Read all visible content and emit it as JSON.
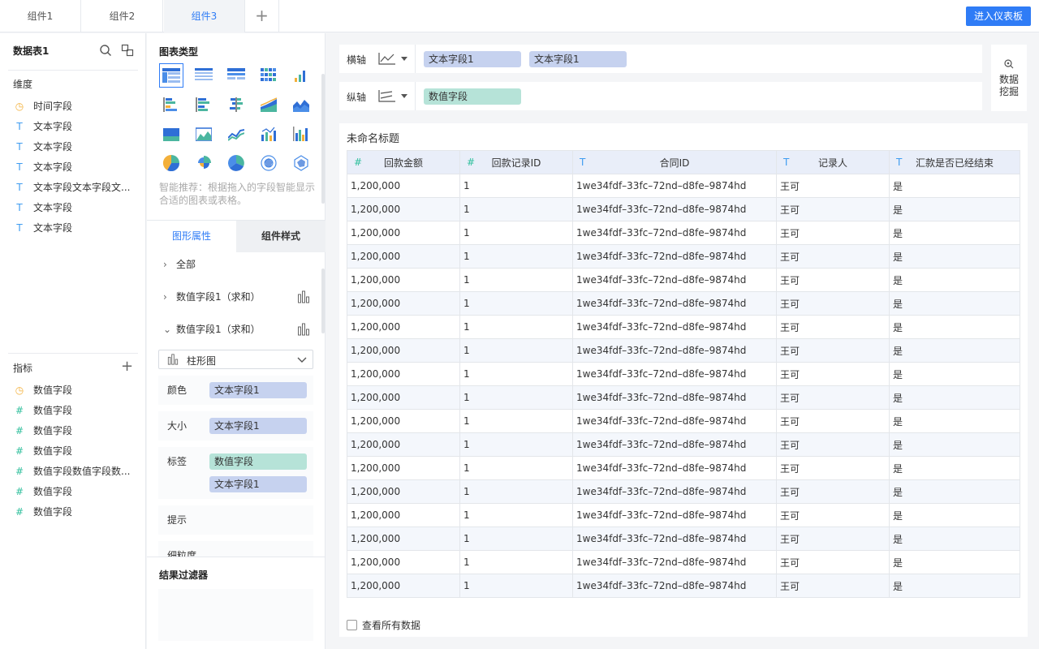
{
  "tabs": [
    {
      "label": "组件1",
      "active": false
    },
    {
      "label": "组件2",
      "active": false
    },
    {
      "label": "组件3",
      "active": true
    }
  ],
  "add_tab_icon": "plus-icon",
  "dashboard_button": "进入仪表板",
  "left": {
    "dataset_title": "数据表1",
    "dimensions_title": "维度",
    "dimensions": [
      {
        "type": "time",
        "label": "时间字段"
      },
      {
        "type": "text",
        "label": "文本字段"
      },
      {
        "type": "text",
        "label": "文本字段"
      },
      {
        "type": "text",
        "label": "文本字段"
      },
      {
        "type": "text",
        "label": "文本字段文本字段文..."
      },
      {
        "type": "text",
        "label": "文本字段"
      },
      {
        "type": "text",
        "label": "文本字段"
      }
    ],
    "metrics_title": "指标",
    "metrics": [
      {
        "type": "time",
        "label": "数值字段"
      },
      {
        "type": "num",
        "label": "数值字段"
      },
      {
        "type": "num",
        "label": "数值字段"
      },
      {
        "type": "num",
        "label": "数值字段"
      },
      {
        "type": "num",
        "label": "数值字段数值字段数..."
      },
      {
        "type": "num",
        "label": "数值字段"
      },
      {
        "type": "num",
        "label": "数值字段"
      }
    ]
  },
  "middle": {
    "chart_type_title": "图表类型",
    "hint": "智能推荐：根据拖入的字段智能显示合适的图表或表格。",
    "prop_tab": "图形属性",
    "style_tab": "组件样式",
    "tree": [
      {
        "label": "全部",
        "expanded": false
      },
      {
        "label": "数值字段1（求和）",
        "expanded": false
      },
      {
        "label": "数值字段1（求和）",
        "expanded": true
      }
    ],
    "chart_select": "柱形图",
    "props": {
      "color_label": "颜色",
      "color_field": "文本字段1",
      "size_label": "大小",
      "size_field": "文本字段1",
      "tag_label": "标签",
      "tag_field_1": "数值字段",
      "tag_field_2": "文本字段1",
      "tip_label": "提示",
      "granularity_label": "细粒度"
    },
    "filter_title": "结果过滤器"
  },
  "axes": {
    "x_label": "横轴",
    "x_fields": [
      "文本字段1",
      "文本字段1"
    ],
    "y_label": "纵轴",
    "y_fields": [
      "数值字段"
    ]
  },
  "mining": "数据挖掘",
  "table": {
    "title": "未命名标题",
    "columns": [
      {
        "type": "#",
        "label": "回款金额"
      },
      {
        "type": "#",
        "label": "回款记录ID"
      },
      {
        "type": "T",
        "label": "合同ID"
      },
      {
        "type": "T",
        "label": "记录人"
      },
      {
        "type": "T",
        "label": "汇款是否已经结束"
      }
    ],
    "rows": [
      [
        "1,200,000",
        "1",
        "1we34fdf–33fc–72nd–d8fe–9874hd",
        "王可",
        "是"
      ],
      [
        "1,200,000",
        "1",
        "1we34fdf–33fc–72nd–d8fe–9874hd",
        "王可",
        "是"
      ],
      [
        "1,200,000",
        "1",
        "1we34fdf–33fc–72nd–d8fe–9874hd",
        "王可",
        "是"
      ],
      [
        "1,200,000",
        "1",
        "1we34fdf–33fc–72nd–d8fe–9874hd",
        "王可",
        "是"
      ],
      [
        "1,200,000",
        "1",
        "1we34fdf–33fc–72nd–d8fe–9874hd",
        "王可",
        "是"
      ],
      [
        "1,200,000",
        "1",
        "1we34fdf–33fc–72nd–d8fe–9874hd",
        "王可",
        "是"
      ],
      [
        "1,200,000",
        "1",
        "1we34fdf–33fc–72nd–d8fe–9874hd",
        "王可",
        "是"
      ],
      [
        "1,200,000",
        "1",
        "1we34fdf–33fc–72nd–d8fe–9874hd",
        "王可",
        "是"
      ],
      [
        "1,200,000",
        "1",
        "1we34fdf–33fc–72nd–d8fe–9874hd",
        "王可",
        "是"
      ],
      [
        "1,200,000",
        "1",
        "1we34fdf–33fc–72nd–d8fe–9874hd",
        "王可",
        "是"
      ],
      [
        "1,200,000",
        "1",
        "1we34fdf–33fc–72nd–d8fe–9874hd",
        "王可",
        "是"
      ],
      [
        "1,200,000",
        "1",
        "1we34fdf–33fc–72nd–d8fe–9874hd",
        "王可",
        "是"
      ],
      [
        "1,200,000",
        "1",
        "1we34fdf–33fc–72nd–d8fe–9874hd",
        "王可",
        "是"
      ],
      [
        "1,200,000",
        "1",
        "1we34fdf–33fc–72nd–d8fe–9874hd",
        "王可",
        "是"
      ],
      [
        "1,200,000",
        "1",
        "1we34fdf–33fc–72nd–d8fe–9874hd",
        "王可",
        "是"
      ],
      [
        "1,200,000",
        "1",
        "1we34fdf–33fc–72nd–d8fe–9874hd",
        "王可",
        "是"
      ],
      [
        "1,200,000",
        "1",
        "1we34fdf–33fc–72nd–d8fe–9874hd",
        "王可",
        "是"
      ],
      [
        "1,200,000",
        "1",
        "1we34fdf–33fc–72nd–d8fe–9874hd",
        "王可",
        "是"
      ]
    ],
    "view_all": "查看所有数据"
  },
  "colors": {
    "accent": "#2f7cf6",
    "pill_blue": "#c6d2ef",
    "pill_green": "#b6e3d8",
    "text_icon": "#3f9cf0",
    "num_icon": "#2fbf9c",
    "time_icon": "#f3b03a"
  }
}
